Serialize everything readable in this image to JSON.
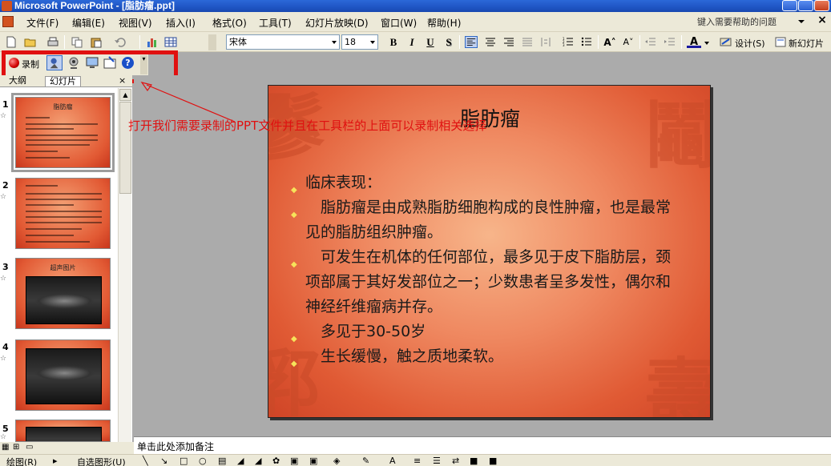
{
  "window": {
    "title": "Microsoft PowerPoint - [脂肪瘤.ppt]"
  },
  "menu": {
    "items": [
      "文件(F)",
      "编辑(E)",
      "视图(V)",
      "插入(I)",
      "格式(O)",
      "工具(T)",
      "幻灯片放映(D)",
      "窗口(W)",
      "帮助(H)"
    ],
    "help_placeholder": "键入需要帮助的问题"
  },
  "toolbar": {
    "font_name": "宋体",
    "font_size": "18",
    "bold": "B",
    "italic": "I",
    "underline": "U",
    "shadow": "S",
    "design_label": "设计(S)",
    "new_slide_label": "新幻灯片"
  },
  "record_toolbar": {
    "record_label": "录制",
    "help_glyph": "?"
  },
  "left_pane": {
    "tabs": [
      "大纲",
      "幻灯片"
    ],
    "close": "×",
    "slides": [
      {
        "num": "1",
        "title": "脂肪瘤",
        "selected": true
      },
      {
        "num": "2",
        "title": "",
        "selected": false
      },
      {
        "num": "3",
        "title": "超声图片",
        "selected": false
      },
      {
        "num": "4",
        "title": "",
        "selected": false
      },
      {
        "num": "5",
        "title": "",
        "selected": false
      }
    ]
  },
  "annotation": "打开我们需要录制的PPT文件并且在工具栏的上面可以录制相关选择",
  "slide": {
    "title": "脂肪瘤",
    "bullets": [
      "临床表现：",
      "　脂肪瘤是由成熟脂肪细胞构成的良性肿瘤，也是最常见的脂肪组织肿瘤。",
      "　可发生在机体的任何部位，最多见于皮下脂肪层，颈项部属于其好发部位之一；少数患者呈多发性，偶尔和神经纤维瘤病并存。",
      "　多见于30-50岁",
      "　生长缓慢，触之质地柔软。"
    ]
  },
  "notes": {
    "placeholder": "单击此处添加备注"
  },
  "draw_toolbar": {
    "draw_label": "绘图(R)",
    "autoshape_label": "自选图形(U)"
  }
}
